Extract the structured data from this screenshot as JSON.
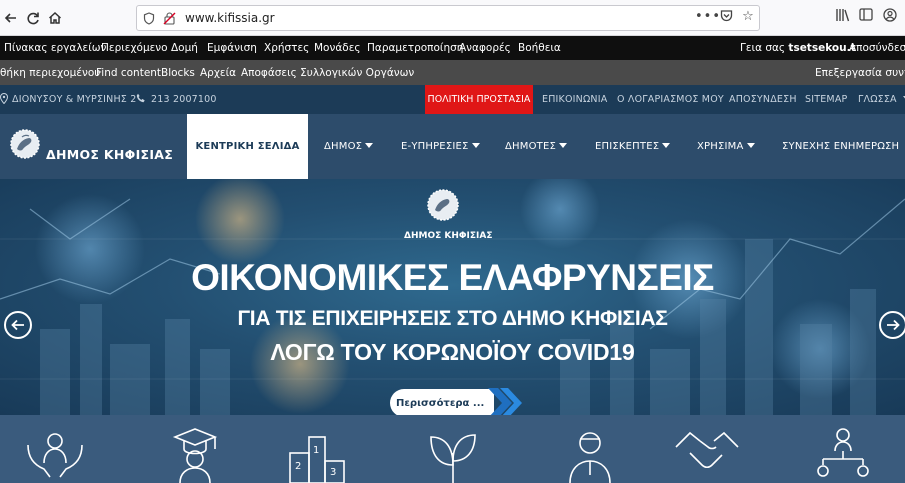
{
  "browser": {
    "url": "www.kifissia.gr"
  },
  "admin_toolbar": {
    "items": [
      "Πίνακας εργαλείων",
      "Περιεχόμενο",
      "Δομή",
      "Εμφάνιση",
      "Χρήστες",
      "Μονάδες",
      "Παραμετροποίηση",
      "Αναφορές",
      "Βοήθεια"
    ],
    "greeting": "Γεια σας",
    "username": "tsetsekou.t",
    "logout": "Αποσύνδεση"
  },
  "shortcuts": {
    "items": [
      "θήκη περιεχομένου",
      "Find content",
      "Blocks",
      "Αρχεία",
      "Αποφάσεις Συλλογικών Οργάνων"
    ],
    "edit_shortcuts": "Επεξεργασία συντομ"
  },
  "info_bar": {
    "address": "ΔΙΟΝΥΣΟΥ & ΜΥΡΣΙΝΗΣ 2",
    "phone": "213 2007100",
    "civil_protection": "ΠΟΛΙΤΙΚΗ ΠΡΟΣΤΑΣΙΑ",
    "contact": "ΕΠΙΚΟΙΝΩΝΙΑ",
    "my_account": "Ο ΛΟΓΑΡΙΑΣΜΟΣ ΜΟΥ",
    "logout": "ΑΠΟΣΥΝΔΕΣΗ",
    "sitemap": "SITEMAP",
    "language": "ΓΛΩΣΣΑ"
  },
  "main_nav": {
    "logo_text": "ΔΗΜΟΣ ΚΗΦΙΣΙΑΣ",
    "home": "ΚΕΝΤΡΙΚΗ ΣΕΛΙΔΑ",
    "municipality": "ΔΗΜΟΣ",
    "e_services": "Ε-ΥΠΗΡΕΣΙΕΣ",
    "citizens": "ΔΗΜΟΤΕΣ",
    "visitors": "ΕΠΙΣΚΕΠΤΕΣ",
    "useful": "ΧΡΗΣΙΜΑ",
    "updates": "ΣΥΝΕΧΗΣ ΕΝΗΜΕΡΩΣΗ"
  },
  "hero": {
    "city": "ΔΗΜΟΣ ΚΗΦΙΣΙΑΣ",
    "title": "ΟΙΚΟΝΟΜΙΚΕΣ ΕΛΑΦΡΥΝΣΕΙΣ",
    "subtitle1": "ΓΙΑ ΤΙΣ ΕΠΙΧΕΙΡΗΣΕΙΣ ΣΤΟ ΔΗΜΟ ΚΗΦΙΣΙΑΣ",
    "subtitle2": "ΛΟΓΩ ΤΟΥ ΚΟΡΩΝΟΪΟΥ COVID19",
    "more": "Περισσότερα ..."
  },
  "colors": {
    "accent_red": "#e01616",
    "nav_blue": "#2d4c6b",
    "info_blue": "#1c3b57"
  },
  "icons": [
    "back-icon",
    "forward-icon",
    "reload-icon",
    "home-icon",
    "shield-icon",
    "no-tracking-icon",
    "more-icon",
    "pocket-icon",
    "star-icon",
    "library-icon",
    "sidebar-icon",
    "account-icon",
    "location-icon",
    "phone-icon",
    "arrow-left-icon",
    "arrow-right-icon",
    "social-care-icon",
    "graduate-icon",
    "podium-icon",
    "leaf-icon",
    "person-icon",
    "handshake-icon",
    "network-icon"
  ]
}
